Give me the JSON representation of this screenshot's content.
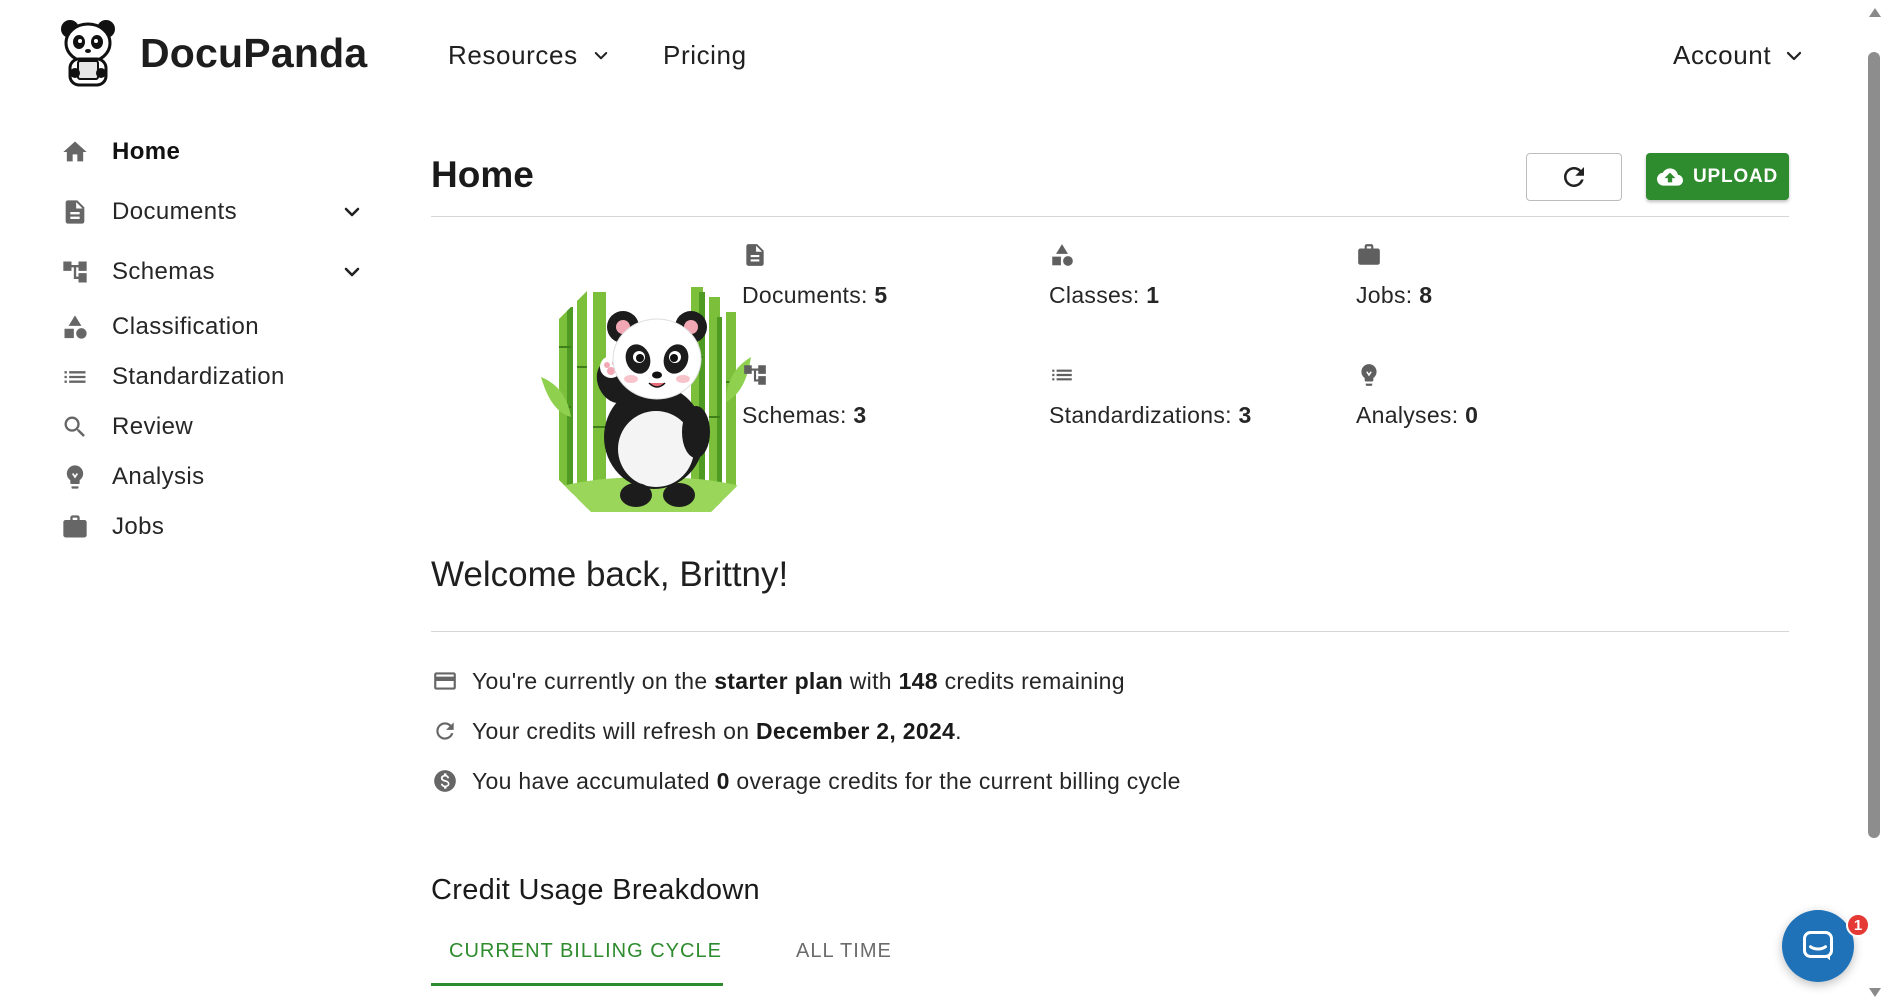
{
  "header": {
    "brand": "DocuPanda",
    "nav": {
      "resources": "Resources",
      "pricing": "Pricing",
      "account": "Account"
    }
  },
  "sidebar": {
    "items": [
      {
        "label": "Home",
        "icon": "home-icon",
        "active": true
      },
      {
        "label": "Documents",
        "icon": "document-icon",
        "expandable": true
      },
      {
        "label": "Schemas",
        "icon": "schema-icon",
        "expandable": true
      },
      {
        "label": "Classification",
        "icon": "shapes-icon"
      },
      {
        "label": "Standardization",
        "icon": "list-icon"
      },
      {
        "label": "Review",
        "icon": "search-icon"
      },
      {
        "label": "Analysis",
        "icon": "lightbulb-icon"
      },
      {
        "label": "Jobs",
        "icon": "briefcase-icon"
      }
    ]
  },
  "main": {
    "title": "Home",
    "upload_label": "UPLOAD",
    "stats": [
      {
        "label": "Documents:",
        "value": "5",
        "icon": "document-icon"
      },
      {
        "label": "Classes:",
        "value": "1",
        "icon": "shapes-icon"
      },
      {
        "label": "Jobs:",
        "value": "8",
        "icon": "briefcase-icon"
      },
      {
        "label": "Schemas:",
        "value": "3",
        "icon": "schema-icon"
      },
      {
        "label": "Standardizations:",
        "value": "3",
        "icon": "list-icon"
      },
      {
        "label": "Analyses:",
        "value": "0",
        "icon": "lightbulb-icon"
      }
    ],
    "welcome": "Welcome back, Brittny!",
    "plan": {
      "prefix": "You're currently on the",
      "plan_name": "starter plan",
      "middle": "with",
      "credits": "148",
      "suffix": "credits remaining"
    },
    "refresh": {
      "prefix": "Your credits will refresh on",
      "date": "December 2, 2024",
      "suffix": "."
    },
    "overage": {
      "prefix": "You have accumulated",
      "value": "0",
      "suffix": "overage credits for the current billing cycle"
    },
    "breakdown": {
      "title": "Credit Usage Breakdown",
      "tabs": [
        "CURRENT BILLING CYCLE",
        "ALL TIME"
      ],
      "active_tab": 0
    }
  },
  "chat": {
    "badge": "1"
  },
  "colors": {
    "accent": "#2e8b2e",
    "chat": "#1f72b8",
    "badge": "#e53935"
  }
}
